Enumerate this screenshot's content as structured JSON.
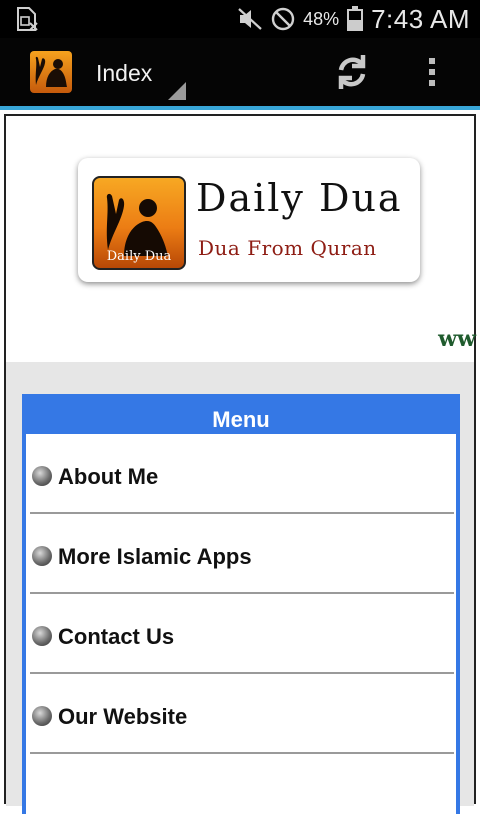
{
  "status_bar": {
    "notification_icon": "sim-card-icon",
    "battery_percent": "48%",
    "time": "7:43 AM"
  },
  "action_bar": {
    "title": "Index",
    "logo_caption": "Daily Dua"
  },
  "banner": {
    "title": "Daily Dua",
    "subtitle": "Dua From Quran",
    "icon_caption": "Daily Dua",
    "scroll_text": "ww"
  },
  "menu": {
    "header": "Menu",
    "items": [
      {
        "label": "About Me"
      },
      {
        "label": "More Islamic Apps"
      },
      {
        "label": "Contact Us"
      },
      {
        "label": "Our Website"
      }
    ]
  },
  "colors": {
    "accent_line": "#38a6d8",
    "menu_blue": "#3578e5",
    "subtitle_red": "#8e1d14",
    "www_green": "#1f5b2d"
  }
}
